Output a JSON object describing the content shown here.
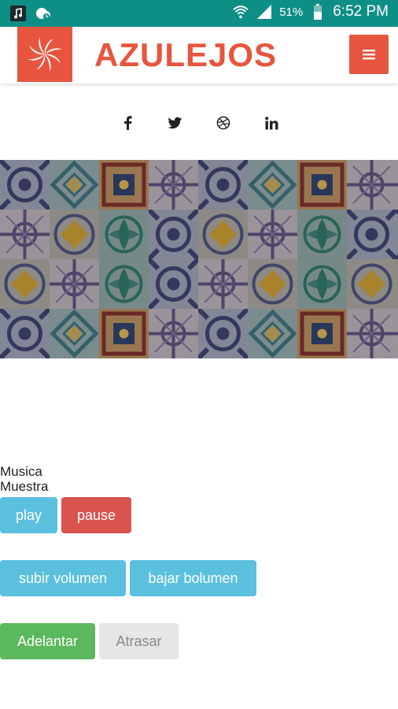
{
  "status_bar": {
    "battery_percent": "51%",
    "time": "6:52 PM",
    "icons": [
      "music-notification-icon",
      "cloud-sync-icon",
      "wifi-icon",
      "signal-icon",
      "battery-icon"
    ]
  },
  "header": {
    "brand": "AZULEJOS",
    "logo_icon": "flower-swirl-logo",
    "menu_icon": "hamburger-menu-icon",
    "accent_color": "#e8553f"
  },
  "social": {
    "links": [
      "facebook-icon",
      "twitter-icon",
      "dribbble-icon",
      "linkedin-icon"
    ]
  },
  "banner": {
    "image": "decorative-azulejo-tiles"
  },
  "audio": {
    "title": "Musica",
    "subtitle": "Muestra"
  },
  "controls": {
    "play": "play",
    "pause": "pause",
    "volume_up": "subir volumen",
    "volume_down": "bajar bolumen",
    "forward": "Adelantar",
    "rewind": "Atrasar"
  },
  "colors": {
    "status_bar": "#0e8f86",
    "info": "#5bc0de",
    "danger": "#d9534f",
    "success": "#5cb85c"
  }
}
